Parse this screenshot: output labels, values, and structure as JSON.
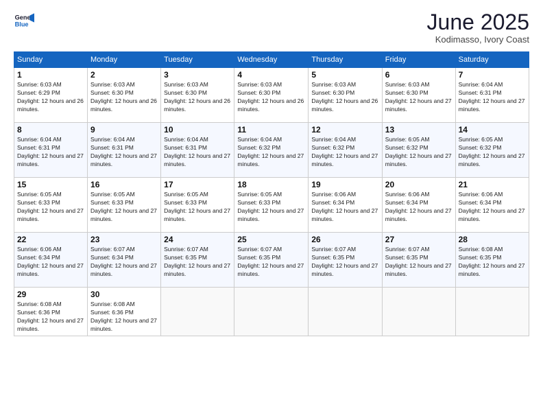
{
  "header": {
    "logo_line1": "General",
    "logo_line2": "Blue",
    "month": "June 2025",
    "location": "Kodimasso, Ivory Coast"
  },
  "days_of_week": [
    "Sunday",
    "Monday",
    "Tuesday",
    "Wednesday",
    "Thursday",
    "Friday",
    "Saturday"
  ],
  "weeks": [
    [
      {
        "day": "1",
        "rise": "6:03 AM",
        "set": "6:29 PM",
        "hours": "12 hours and 26 minutes."
      },
      {
        "day": "2",
        "rise": "6:03 AM",
        "set": "6:30 PM",
        "hours": "12 hours and 26 minutes."
      },
      {
        "day": "3",
        "rise": "6:03 AM",
        "set": "6:30 PM",
        "hours": "12 hours and 26 minutes."
      },
      {
        "day": "4",
        "rise": "6:03 AM",
        "set": "6:30 PM",
        "hours": "12 hours and 26 minutes."
      },
      {
        "day": "5",
        "rise": "6:03 AM",
        "set": "6:30 PM",
        "hours": "12 hours and 26 minutes."
      },
      {
        "day": "6",
        "rise": "6:03 AM",
        "set": "6:30 PM",
        "hours": "12 hours and 27 minutes."
      },
      {
        "day": "7",
        "rise": "6:04 AM",
        "set": "6:31 PM",
        "hours": "12 hours and 27 minutes."
      }
    ],
    [
      {
        "day": "8",
        "rise": "6:04 AM",
        "set": "6:31 PM",
        "hours": "12 hours and 27 minutes."
      },
      {
        "day": "9",
        "rise": "6:04 AM",
        "set": "6:31 PM",
        "hours": "12 hours and 27 minutes."
      },
      {
        "day": "10",
        "rise": "6:04 AM",
        "set": "6:31 PM",
        "hours": "12 hours and 27 minutes."
      },
      {
        "day": "11",
        "rise": "6:04 AM",
        "set": "6:32 PM",
        "hours": "12 hours and 27 minutes."
      },
      {
        "day": "12",
        "rise": "6:04 AM",
        "set": "6:32 PM",
        "hours": "12 hours and 27 minutes."
      },
      {
        "day": "13",
        "rise": "6:05 AM",
        "set": "6:32 PM",
        "hours": "12 hours and 27 minutes."
      },
      {
        "day": "14",
        "rise": "6:05 AM",
        "set": "6:32 PM",
        "hours": "12 hours and 27 minutes."
      }
    ],
    [
      {
        "day": "15",
        "rise": "6:05 AM",
        "set": "6:33 PM",
        "hours": "12 hours and 27 minutes."
      },
      {
        "day": "16",
        "rise": "6:05 AM",
        "set": "6:33 PM",
        "hours": "12 hours and 27 minutes."
      },
      {
        "day": "17",
        "rise": "6:05 AM",
        "set": "6:33 PM",
        "hours": "12 hours and 27 minutes."
      },
      {
        "day": "18",
        "rise": "6:05 AM",
        "set": "6:33 PM",
        "hours": "12 hours and 27 minutes."
      },
      {
        "day": "19",
        "rise": "6:06 AM",
        "set": "6:34 PM",
        "hours": "12 hours and 27 minutes."
      },
      {
        "day": "20",
        "rise": "6:06 AM",
        "set": "6:34 PM",
        "hours": "12 hours and 27 minutes."
      },
      {
        "day": "21",
        "rise": "6:06 AM",
        "set": "6:34 PM",
        "hours": "12 hours and 27 minutes."
      }
    ],
    [
      {
        "day": "22",
        "rise": "6:06 AM",
        "set": "6:34 PM",
        "hours": "12 hours and 27 minutes."
      },
      {
        "day": "23",
        "rise": "6:07 AM",
        "set": "6:34 PM",
        "hours": "12 hours and 27 minutes."
      },
      {
        "day": "24",
        "rise": "6:07 AM",
        "set": "6:35 PM",
        "hours": "12 hours and 27 minutes."
      },
      {
        "day": "25",
        "rise": "6:07 AM",
        "set": "6:35 PM",
        "hours": "12 hours and 27 minutes."
      },
      {
        "day": "26",
        "rise": "6:07 AM",
        "set": "6:35 PM",
        "hours": "12 hours and 27 minutes."
      },
      {
        "day": "27",
        "rise": "6:07 AM",
        "set": "6:35 PM",
        "hours": "12 hours and 27 minutes."
      },
      {
        "day": "28",
        "rise": "6:08 AM",
        "set": "6:35 PM",
        "hours": "12 hours and 27 minutes."
      }
    ],
    [
      {
        "day": "29",
        "rise": "6:08 AM",
        "set": "6:36 PM",
        "hours": "12 hours and 27 minutes."
      },
      {
        "day": "30",
        "rise": "6:08 AM",
        "set": "6:36 PM",
        "hours": "12 hours and 27 minutes."
      },
      null,
      null,
      null,
      null,
      null
    ]
  ]
}
